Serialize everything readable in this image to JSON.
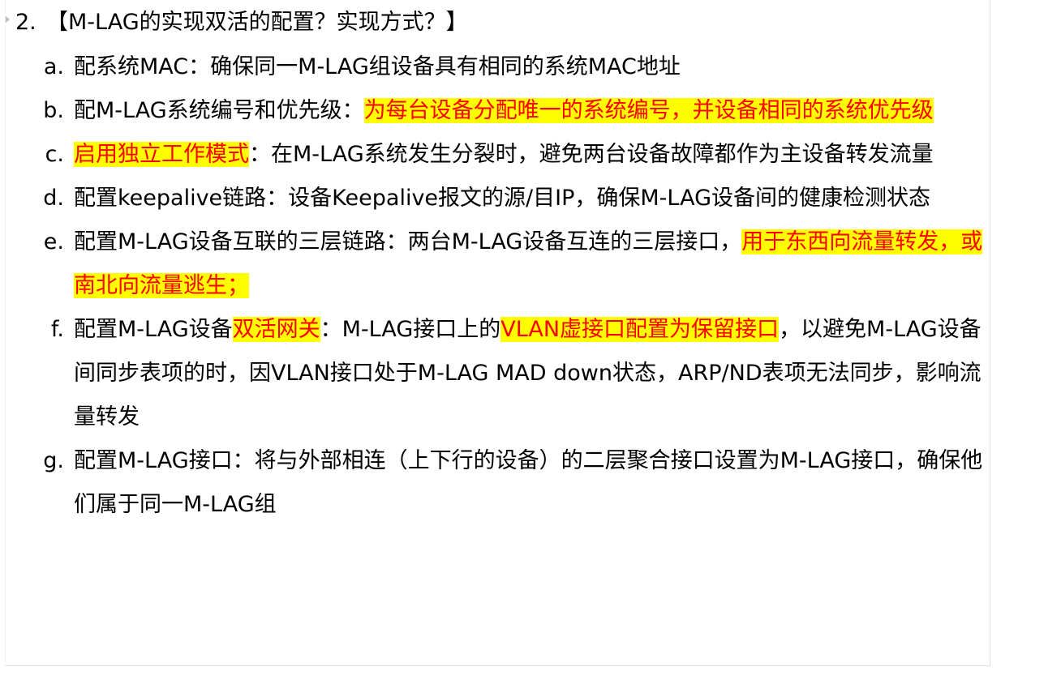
{
  "heading": {
    "number": "2.",
    "text": "【M-LAG的实现双活的配置？实现方式？】"
  },
  "items": [
    {
      "marker": "a.",
      "segments": [
        {
          "text": "配系统MAC：确保同一M-LAG组设备具有相同的系统MAC地址",
          "highlight": false
        }
      ]
    },
    {
      "marker": "b.",
      "segments": [
        {
          "text": "配M-LAG系统编号和优先级：",
          "highlight": false
        },
        {
          "text": "为每台设备分配唯一的系统编号，并设备相同的系统优先级",
          "highlight": true
        }
      ]
    },
    {
      "marker": "c.",
      "segments": [
        {
          "text": "启用独立工作模式",
          "highlight": true
        },
        {
          "text": "：在M-LAG系统发生分裂时，避免两台设备故障都作为主设备转发流量",
          "highlight": false
        }
      ]
    },
    {
      "marker": "d.",
      "segments": [
        {
          "text": "配置keepalive链路：设备Keepalive报文的源/目IP，确保M-LAG设备间的健康检测状态",
          "highlight": false
        }
      ]
    },
    {
      "marker": "e.",
      "segments": [
        {
          "text": "配置M-LAG设备互联的三层链路：两台M-LAG设备互连的三层接口，",
          "highlight": false
        },
        {
          "text": "用于东西向流量转发，或南北向流量逃生；",
          "highlight": true
        }
      ]
    },
    {
      "marker": "f.",
      "segments": [
        {
          "text": "配置M-LAG设备",
          "highlight": false
        },
        {
          "text": "双活网关",
          "highlight": true
        },
        {
          "text": "：M-LAG接口上的",
          "highlight": false
        },
        {
          "text": "VLAN虚接口配置为保留接口",
          "highlight": true
        },
        {
          "text": "，以避免M-LAG设备间同步表项的时，因VLAN接口处于M-LAG MAD down状态，ARP/ND表项无法同步，影响流量转发",
          "highlight": false
        }
      ]
    },
    {
      "marker": "g.",
      "segments": [
        {
          "text": "配置M-LAG接口：将与外部相连（上下行的设备）的二层聚合接口设置为M-LAG接口，确保他们属于同一M-LAG组",
          "highlight": false
        }
      ]
    }
  ],
  "colors": {
    "highlight_background": "#ffff00",
    "highlight_text": "#ff0000",
    "text": "#000000"
  }
}
